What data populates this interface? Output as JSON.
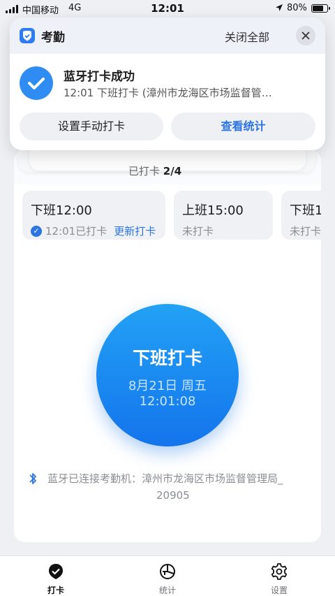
{
  "status_bar": {
    "carrier": "中国移动",
    "network": "4G",
    "time": "12:01",
    "battery_percent": "80%",
    "battery_level": 0.8
  },
  "notification": {
    "app_name": "考勤",
    "close_all": "关闭全部",
    "title": "蓝牙打卡成功",
    "body": "12:01 下班打卡 (漳州市龙海区市场监督管…",
    "button_manual": "设置手动打卡",
    "button_stats": "查看统计",
    "accent_color": "#2b74e2"
  },
  "summary": {
    "prefix": "已打卡",
    "count": "2/4"
  },
  "shifts": [
    {
      "time": "下班12:00",
      "status": "12:01已打卡",
      "action": "更新打卡",
      "done": true
    },
    {
      "time": "上班15:00",
      "status": "未打卡",
      "done": false
    },
    {
      "time": "下班1",
      "status": "未打卡",
      "done": false
    }
  ],
  "punch_button": {
    "label": "下班打卡",
    "date": "8月21日 周五",
    "time": "12:01:08"
  },
  "bluetooth": {
    "line1": "蓝牙已连接考勤机：漳州市龙海区市场监督管理局_",
    "line2": "20905"
  },
  "tabs": [
    {
      "label": "打卡",
      "icon": "check-badge-icon",
      "active": true
    },
    {
      "label": "统计",
      "icon": "pie-chart-icon",
      "active": false
    },
    {
      "label": "设置",
      "icon": "gear-icon",
      "active": false
    }
  ]
}
